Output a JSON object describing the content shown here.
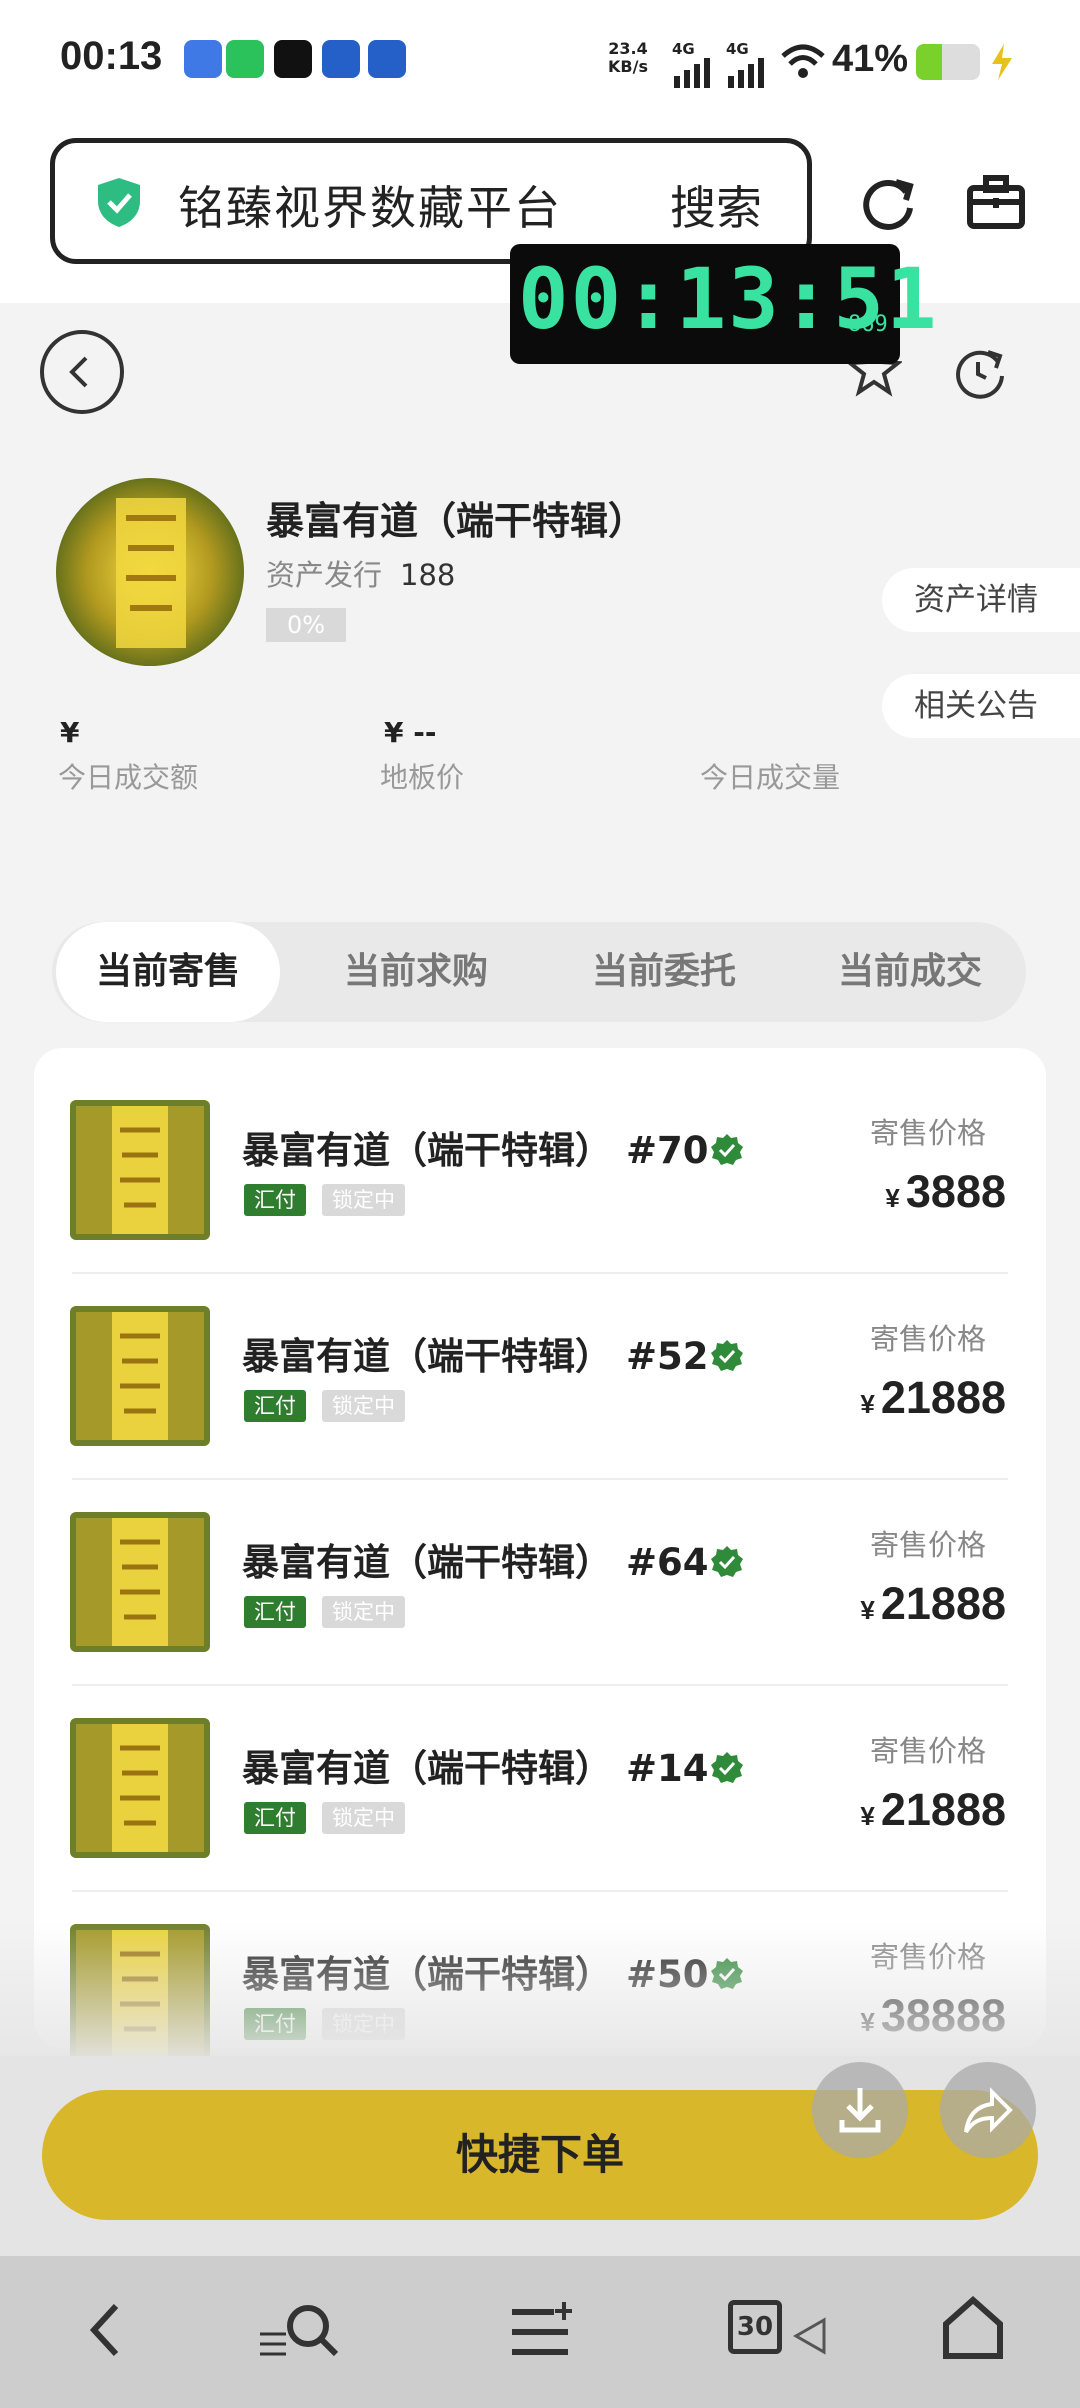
{
  "status_bar": {
    "time": "00:13",
    "net_speed_top": "23.4",
    "net_speed_bottom": "KB/s",
    "sig1": "4G",
    "sig2": "4G",
    "battery_text": "41%",
    "battery_level": 0.41
  },
  "browser": {
    "url_text": "铭臻视界数藏平台",
    "search_label": "搜索"
  },
  "timer": {
    "display": "00:13:51",
    "ms": "869"
  },
  "product": {
    "title": "暴富有道（端干特辑）",
    "issue_label": "资产发行",
    "issue_count": "188",
    "progress": "0%",
    "asset_details": "资产详情",
    "announcements": "相关公告"
  },
  "stats": [
    {
      "value": "¥",
      "label": "今日成交额"
    },
    {
      "value": "¥ --",
      "label": "地板价"
    },
    {
      "value": "",
      "label": "今日成交量"
    }
  ],
  "tabs": [
    "当前寄售",
    "当前求购",
    "当前委托",
    "当前成交"
  ],
  "listing": {
    "price_label": "寄售价格",
    "badge_pay": "汇付",
    "badge_lock": "锁定中",
    "currency": "¥",
    "items": [
      {
        "name": "暴富有道（端干特辑）",
        "num": "#70",
        "price": "3888"
      },
      {
        "name": "暴富有道（端干特辑）",
        "num": "#52",
        "price": "21888"
      },
      {
        "name": "暴富有道（端干特辑）",
        "num": "#64",
        "price": "21888"
      },
      {
        "name": "暴富有道（端干特辑）",
        "num": "#14",
        "price": "21888"
      },
      {
        "name": "暴富有道（端干特辑）",
        "num": "#50",
        "price": "38888"
      }
    ]
  },
  "order_button": "快捷下单",
  "nav": {
    "tabs_count": "30"
  },
  "colors": {
    "accent": "#d9b72a",
    "badge_green": "#2f7d2f",
    "timer_green": "#39e2a0"
  }
}
